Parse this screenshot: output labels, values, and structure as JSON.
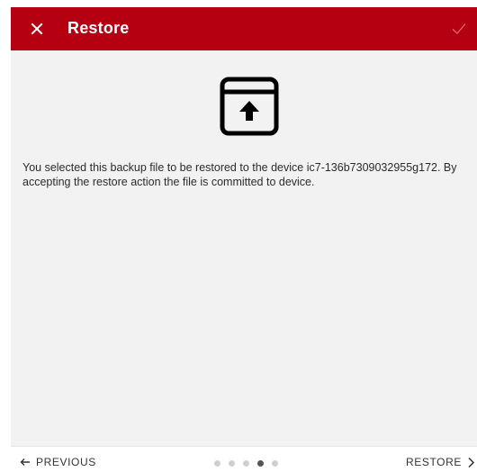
{
  "header": {
    "close_icon": "close-icon",
    "title": "Restore",
    "confirm_icon": "checkmark-icon"
  },
  "content": {
    "icon": "archive-upload-icon",
    "message": "You selected this backup file to be restored to the device ic7-136b7309032955g172. By accepting the restore action the file is committed to device."
  },
  "footer": {
    "previous_label": "PREVIOUS",
    "previous_icon": "arrow-left-icon",
    "restore_label": "RESTORE",
    "restore_icon": "chevron-right-icon",
    "steps_total": 5,
    "active_step": 4
  },
  "colors": {
    "accent": "#b50012",
    "content_bg": "#f2f2f2",
    "dot_inactive": "#cfcfcf",
    "dot_active": "#555555"
  }
}
